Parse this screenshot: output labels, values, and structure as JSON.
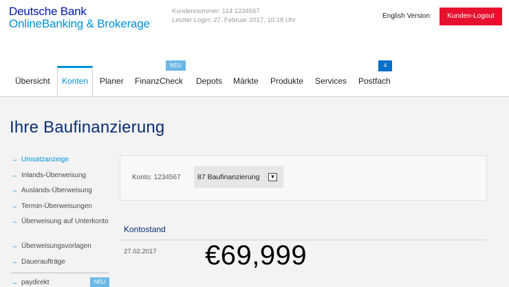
{
  "brand": {
    "line1": "Deutsche Bank",
    "line2": "OnlineBanking & Brokerage"
  },
  "meta": {
    "customer": "Kundennummer: 114 1234567",
    "last_login": "Letzter Login: 27. Februar 2017, 10:18 Uhr"
  },
  "header": {
    "english_label": "English Version",
    "logout_label": "Kunden-Logout"
  },
  "nav": {
    "items": [
      {
        "label": "Übersicht"
      },
      {
        "label": "Konten"
      },
      {
        "label": "Planer"
      },
      {
        "label": "FinanzCheck"
      },
      {
        "label": "Depots"
      },
      {
        "label": "Märkte"
      },
      {
        "label": "Produkte"
      },
      {
        "label": "Services"
      },
      {
        "label": "Postfach"
      }
    ],
    "active": "Konten",
    "neu_badge": "NEU",
    "postfach_count": "4"
  },
  "page": {
    "title": "Ihre Baufinanzierung"
  },
  "sidebar": {
    "items": [
      {
        "label": "Umsatzanzeige"
      },
      {
        "label": "Inlands-Überweisung"
      },
      {
        "label": "Auslands-Überweisung"
      },
      {
        "label": "Termin-Überweisungen"
      },
      {
        "label": "Überweisung auf Unterkonto"
      },
      {
        "label": "Überweisungsvorlagen"
      },
      {
        "label": "Daueraufträge"
      },
      {
        "label": "paydirekt"
      }
    ],
    "neu_badge": "NEU"
  },
  "konto": {
    "label": "Konto: 1234567",
    "selected": "87 Baufinanzierung"
  },
  "kontostand": {
    "title": "Kontostand",
    "date": "27.02.2017",
    "amount": "€69,999"
  },
  "colors": {
    "brand_dark": "#0018a8",
    "brand_light": "#0090d8",
    "logout_red": "#e8112d",
    "title_navy": "#0a2d73"
  }
}
